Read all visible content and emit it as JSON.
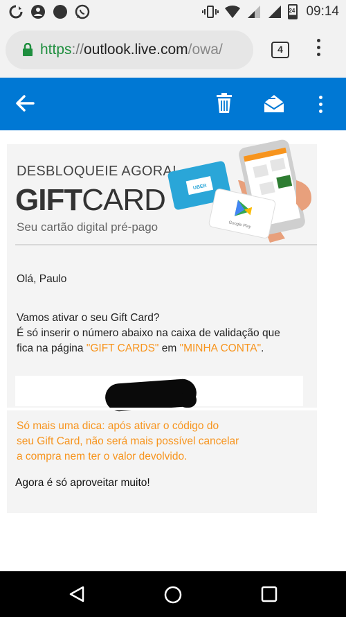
{
  "status_bar": {
    "time": "09:14",
    "battery_level": "24"
  },
  "browser": {
    "url_scheme": "https",
    "url_sep": "://",
    "url_host": "outlook.live.com",
    "url_path": "/owa/",
    "tab_count": "4"
  },
  "email": {
    "banner": {
      "headline": "DESBLOQUEIE AGORA!",
      "brand_bold": "GIFT",
      "brand_light": "CARD",
      "subtitle": "Seu cartão digital pré-pago",
      "card1_label": "UBER",
      "card2_label": "Google Play"
    },
    "greeting": "Olá, Paulo",
    "para1_line1": "Vamos ativar o seu Gift Card?",
    "para1_line2": "É só inserir o número abaixo na caixa de validação que",
    "para1_line3_prefix": "fica na página ",
    "para1_link1": "\"GIFT CARDS\"",
    "para1_mid": " em ",
    "para1_link2": "\"MINHA CONTA\"",
    "para1_end": ".",
    "tip_line1": "Só mais uma dica: após ativar o código do",
    "tip_line2": "seu Gift Card, não será mais possível cancelar",
    "tip_line3": "a compra nem ter o valor devolvido.",
    "closing": "Agora é só aproveitar muito!"
  },
  "colors": {
    "appbar": "#0078d4",
    "accent_orange": "#f7941d",
    "lock_green": "#1e8e3e"
  }
}
